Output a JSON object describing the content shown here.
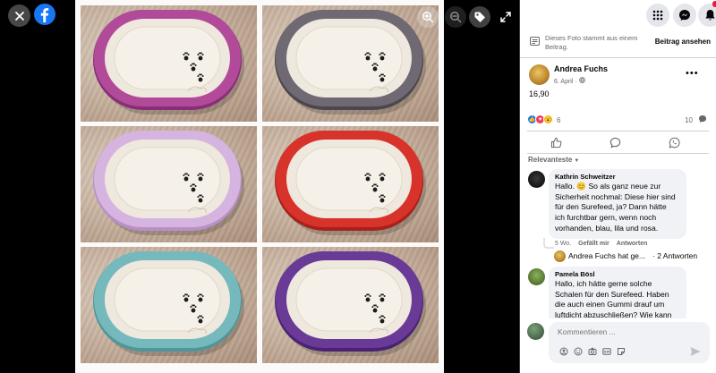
{
  "viewer": {
    "close_icon": "close-icon",
    "logo_icon": "facebook-logo",
    "controls": [
      "zoom-in-icon",
      "zoom-out-icon",
      "tag-icon",
      "fullscreen-icon"
    ],
    "plates": [
      {
        "rim": "#b24a9a",
        "rim_dark": "#8a2d78",
        "paws": true
      },
      {
        "rim": "#6e6972",
        "rim_dark": "#4b474e",
        "paws": true
      },
      {
        "rim": "#d6b4e0",
        "rim_dark": "#b98fc8",
        "paws": true
      },
      {
        "rim": "#d8332b",
        "rim_dark": "#a8201a",
        "paws": true
      },
      {
        "rim": "#76b9bd",
        "rim_dark": "#4e9699",
        "paws": true
      },
      {
        "rim": "#6a3a97",
        "rim_dark": "#4a2273",
        "paws": true
      }
    ]
  },
  "topbar": {
    "menu_icon": "grid-menu-icon",
    "messenger_icon": "messenger-icon",
    "notifications_icon": "bell-icon"
  },
  "post": {
    "source_note": "Dieses Foto stammt aus einem Beitrag.",
    "source_link": "Beitrag ansehen",
    "author": "Andrea Fuchs",
    "date": "6. April · ",
    "privacy_icon": "globe-icon",
    "text": "16,90",
    "reaction_count": "6",
    "comment_count": "10",
    "reaction_colors": {
      "like": "#1877f2",
      "love": "#f33e58",
      "wow": "#f7b125"
    }
  },
  "actions": {
    "like_icon": "thumbs-up-icon",
    "comment_icon": "comment-bubble-icon",
    "share_icon": "whatsapp-icon"
  },
  "sort": {
    "label": "Relevanteste"
  },
  "comments": [
    {
      "name": "Kathrin Schweitzer",
      "lines": [
        "Hallo. 😊 So als ganz neue zur",
        "Sicherheit nochmal: Diese hier sind",
        "für den Surefeed, ja? Dann hätte",
        "ich furchtbar gern, wenn noch",
        "vorhanden, blau, lila und rosa."
      ],
      "age": "5 Wo.",
      "liked": "Gefällt mir",
      "reply": "Antworten",
      "reply_preview": "Andrea Fuchs hat ge...",
      "reply_count": "· 2 Antworten"
    },
    {
      "name": "Pamela Bösl",
      "lines": [
        "Hallo, ich hätte gerne solche",
        "Schalen für den Surefeed. Haben",
        "die auch einen Gummi drauf um",
        "luftdicht abzuschließen? Wie kann"
      ]
    }
  ],
  "composer": {
    "placeholder": "Kommentieren ...",
    "tools": [
      "avatar-sticker-icon",
      "emoji-icon",
      "camera-icon",
      "gif-icon",
      "sticker-icon"
    ],
    "send_icon": "send-icon"
  }
}
